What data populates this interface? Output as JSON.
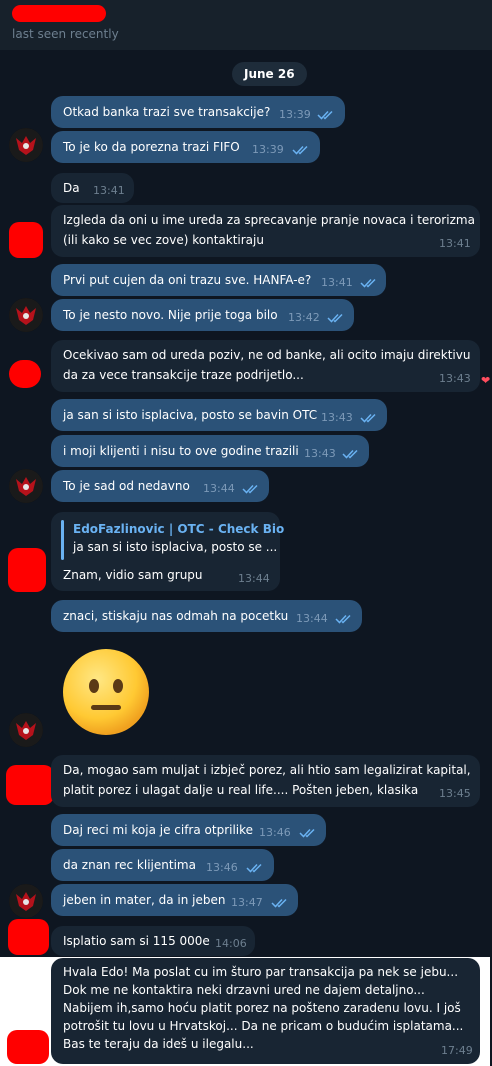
{
  "header": {
    "status": "last seen recently"
  },
  "date": "June 26",
  "messages": [
    {
      "text": "Otkad banka trazi sve transakcije?",
      "time": "13:39"
    },
    {
      "text": "To je ko da porezna trazi FIFO",
      "time": "13:39"
    },
    {
      "text": "Da",
      "time": "13:41"
    },
    {
      "lines": [
        "Izgleda da oni u ime ureda za sprecavanje pranje novaca i terorizma",
        "(ili kako se vec zove) kontaktiraju"
      ],
      "time": "13:41"
    },
    {
      "text": "Prvi put cujen da oni trazu sve. HANFA-e?",
      "time": "13:41"
    },
    {
      "text": "To je nesto novo. Nije prije toga bilo",
      "time": "13:42"
    },
    {
      "lines": [
        "Ocekivao sam od ureda poziv, ne od banke, ali ocito imaju direktivu",
        "da za vece transakcije traze podrijetlo..."
      ],
      "time": "13:43"
    },
    {
      "text": "ja san si isto isplaciva, posto se bavin OTC",
      "time": "13:43"
    },
    {
      "text": "i moji klijenti i nisu to ove godine trazili",
      "time": "13:43"
    },
    {
      "text": "To je sad od nedavno",
      "time": "13:44"
    },
    {
      "quote_name": "EdoFazlinovic | OTC - Check Bio",
      "quote_text": "ja san si isto isplaciva, posto se ...",
      "text": "Znam, vidio sam grupu",
      "time": "13:44"
    },
    {
      "text": "znaci, stiskaju nas odmah na pocetku",
      "time": "13:44"
    },
    {
      "lines": [
        "Da, mogao sam muljat i izbječ porez, ali htio sam legalizirat kapital,",
        "platit porez i ulagat dalje u real life.... Pošten jeben, klasika"
      ],
      "time": "13:45"
    },
    {
      "text": "Daj reci mi koja je cifra otprilike",
      "time": "13:46"
    },
    {
      "text": "da znan rec klijentima",
      "time": "13:46"
    },
    {
      "text": "jeben in mater, da in jeben",
      "time": "13:47"
    },
    {
      "text": "Isplatio sam si 115 000e",
      "time": "14:06"
    },
    {
      "lines": [
        "Hvala Edo! Ma poslat cu im šturo par transakcija pa nek se jebu...",
        "Dok me ne kontaktira neki drzavni ured ne dajem detaljno...",
        "Nabijem ih,samo hoću platit porez na pošteno zaradenu lovu. I još",
        "potrošit tu lovu u Hrvatskoj... Da ne pricam o budućim isplatama...",
        "Bas te teraju da ideš u ilegalu..."
      ],
      "time": "17:49"
    }
  ],
  "colors": {
    "background": "#0e1621",
    "outgoing_bubble": "#2b5278",
    "incoming_bubble": "#182533",
    "accent": "#6ab2f2",
    "redaction": "#ff0000"
  }
}
